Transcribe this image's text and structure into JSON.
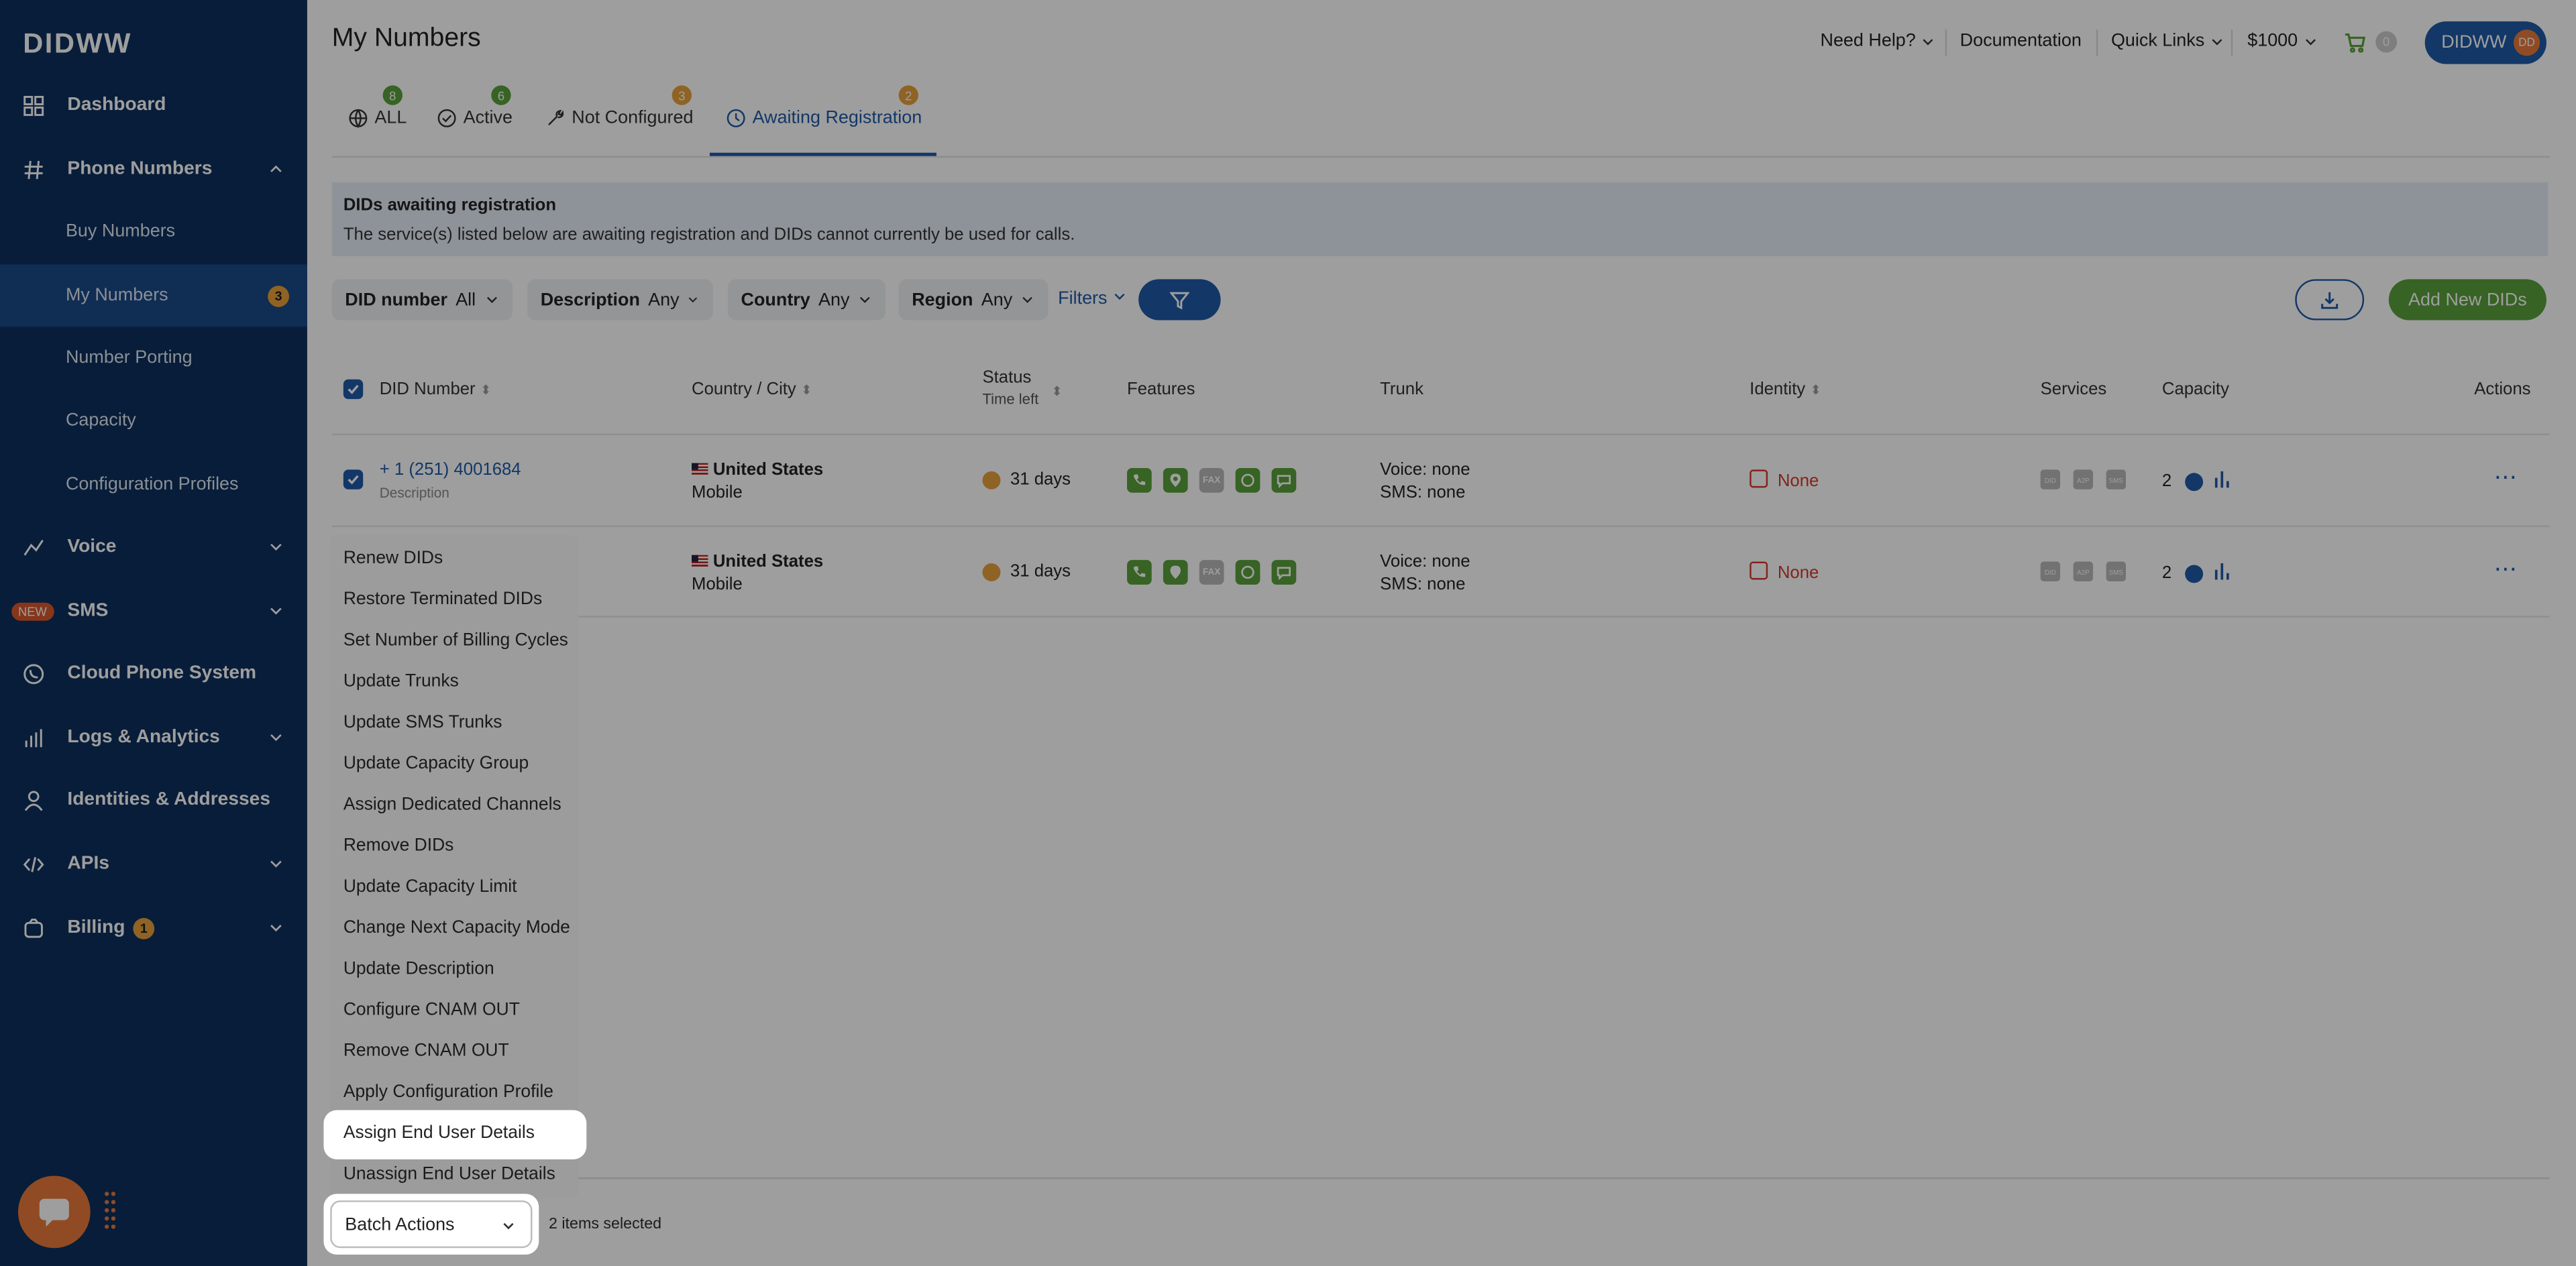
{
  "brand": {
    "logo": "DIDWW"
  },
  "sidebar": {
    "items": [
      {
        "label": "Dashboard",
        "icon": "grid-icon"
      },
      {
        "label": "Phone Numbers",
        "icon": "hash-icon"
      },
      {
        "label": "Voice",
        "icon": "voice-icon"
      },
      {
        "label": "SMS",
        "icon": "sms-icon",
        "tag": "NEW"
      },
      {
        "label": "Cloud Phone System",
        "icon": "phone-circle-icon"
      },
      {
        "label": "Logs & Analytics",
        "icon": "bar-chart-icon"
      },
      {
        "label": "Identities & Addresses",
        "icon": "user-icon"
      },
      {
        "label": "APIs",
        "icon": "code-icon"
      },
      {
        "label": "Billing",
        "icon": "wallet-icon",
        "badge": "1"
      }
    ],
    "phone_sub": [
      {
        "label": "Buy Numbers"
      },
      {
        "label": "My Numbers",
        "badge": "3"
      },
      {
        "label": "Number Porting"
      },
      {
        "label": "Capacity"
      },
      {
        "label": "Configuration Profiles"
      }
    ]
  },
  "header": {
    "title": "My Numbers",
    "help": "Need Help?",
    "docs": "Documentation",
    "quick_links": "Quick Links",
    "balance": "$1000",
    "cart_count": "0",
    "account": "DIDWW",
    "avatar_initials": "DD"
  },
  "tabs": [
    {
      "label": "ALL",
      "count": "8",
      "badge_color": "#5aa03a"
    },
    {
      "label": "Active",
      "count": "6",
      "badge_color": "#5aa03a"
    },
    {
      "label": "Not Configured",
      "count": "3",
      "badge_color": "#e7a13a"
    },
    {
      "label": "Awaiting Registration",
      "count": "2",
      "badge_color": "#e7a13a",
      "active": true
    }
  ],
  "notice": {
    "title": "DIDs awaiting registration",
    "text": "The service(s) listed below are awaiting registration and DIDs cannot currently be used for calls."
  },
  "filters": [
    {
      "label": "DID number",
      "value": "All"
    },
    {
      "label": "Description",
      "value": "Any"
    },
    {
      "label": "Country",
      "value": "Any"
    },
    {
      "label": "Region",
      "value": "Any"
    }
  ],
  "filters_link": "Filters",
  "add_button": "Add New DIDs",
  "table": {
    "columns": {
      "did": "DID Number",
      "country": "Country / City",
      "status": "Status",
      "status_sub": "Time left",
      "features": "Features",
      "trunk": "Trunk",
      "identity": "Identity",
      "services": "Services",
      "capacity": "Capacity",
      "actions": "Actions"
    },
    "rows": [
      {
        "did": "+ 1 (251) 4001684",
        "description": "Description",
        "country": "United States",
        "city": "Mobile",
        "time_left": "31 days",
        "trunk_voice": "Voice: none",
        "trunk_sms": "SMS: none",
        "identity": "None",
        "capacity": "2"
      },
      {
        "did": "",
        "description": "",
        "country": "United States",
        "city": "Mobile",
        "time_left": "31 days",
        "trunk_voice": "Voice: none",
        "trunk_sms": "SMS: none",
        "identity": "None",
        "capacity": "2"
      }
    ],
    "feature_labels": {
      "fax": "FAX"
    },
    "service_labels": [
      "DID",
      "A2P",
      "SMS"
    ]
  },
  "batch_menu": [
    "Renew DIDs",
    "Restore Terminated DIDs",
    "Set Number of Billing Cycles",
    "Update Trunks",
    "Update SMS Trunks",
    "Update Capacity Group",
    "Assign Dedicated Channels",
    "Remove DIDs",
    "Update Capacity Limit",
    "Change Next Capacity Mode",
    "Update Description",
    "Configure CNAM OUT",
    "Remove CNAM OUT",
    "Apply Configuration Profile",
    "Assign End User Details",
    "Unassign End User Details"
  ],
  "batch": {
    "label": "Batch Actions",
    "selected": "2 items selected"
  },
  "colors": {
    "sidebar": "#0d2f5c",
    "accent": "#1f5aa6",
    "green": "#5aa03a",
    "orange": "#e7a13a",
    "red": "#d23b2a"
  }
}
